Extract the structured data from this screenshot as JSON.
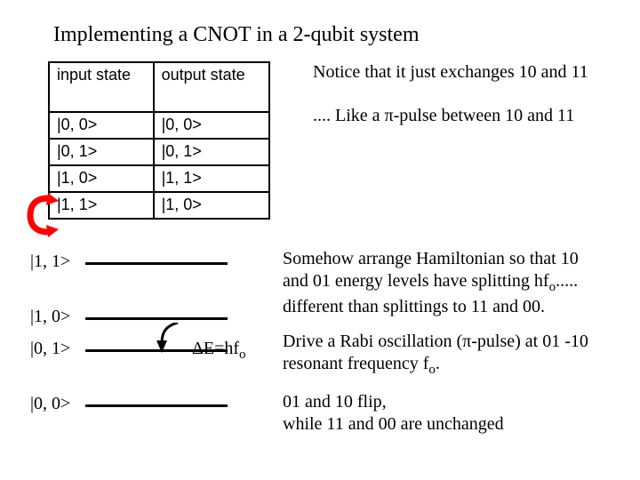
{
  "title": "Implementing a CNOT in a 2-qubit system",
  "table": {
    "headers": {
      "in": "input state",
      "out": "output state"
    },
    "rows": [
      {
        "in": "|0, 0>",
        "out": "|0, 0>"
      },
      {
        "in": "|0, 1>",
        "out": "|0, 1>"
      },
      {
        "in": "|1, 0>",
        "out": "|1, 1>"
      },
      {
        "in": "|1, 1>",
        "out": "|1, 0>"
      }
    ]
  },
  "notes": {
    "n1": "Notice that it just exchanges 10 and 11",
    "n2": ".... Like a π-pulse between  10 and 11"
  },
  "levels": {
    "l0": "|1, 1>",
    "l1": "|1, 0>",
    "l2": "|0, 1>",
    "l3": "|0, 0>",
    "delta_prefix": "ΔE=hf",
    "delta_sub": "o"
  },
  "paras": {
    "p1_a": "Somehow arrange Hamiltonian so that 10 and 01 energy levels have splitting hf",
    "p1_sub": "o",
    "p1_b": "..... different than splittings to 11 and 00.",
    "p2_a": "Drive a Rabi oscillation (π-pulse) at 01 -10 resonant frequency f",
    "p2_sub": "o",
    "p2_b": ".",
    "p3": "01 and 10 flip,\nwhile 11 and 00 are unchanged"
  }
}
